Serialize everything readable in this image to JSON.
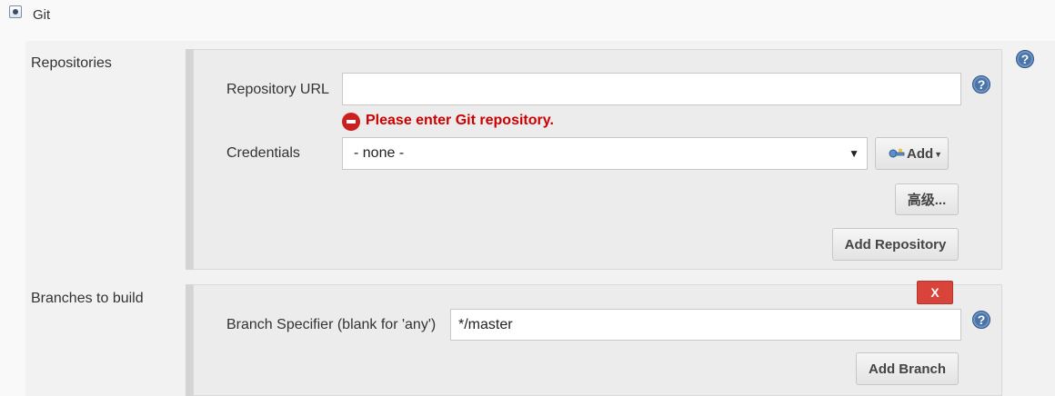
{
  "scm": {
    "option_label": "Git"
  },
  "repositories": {
    "section_label": "Repositories",
    "url_label": "Repository URL",
    "url_value": "",
    "error_message": "Please enter Git repository.",
    "credentials_label": "Credentials",
    "credentials_selected": "- none -",
    "add_label": "Add",
    "advanced_label": "高级...",
    "add_repository_label": "Add Repository"
  },
  "branches": {
    "section_label": "Branches to build",
    "delete_label": "X",
    "specifier_label": "Branch Specifier (blank for 'any')",
    "specifier_value": "*/master",
    "add_branch_label": "Add Branch"
  },
  "icons": {
    "help": "help-icon",
    "error": "error-icon",
    "key": "key-icon",
    "radio": "radio-checked-icon"
  },
  "colors": {
    "error": "#cc0000",
    "help": "#4a73a8",
    "delete": "#d9443a"
  }
}
